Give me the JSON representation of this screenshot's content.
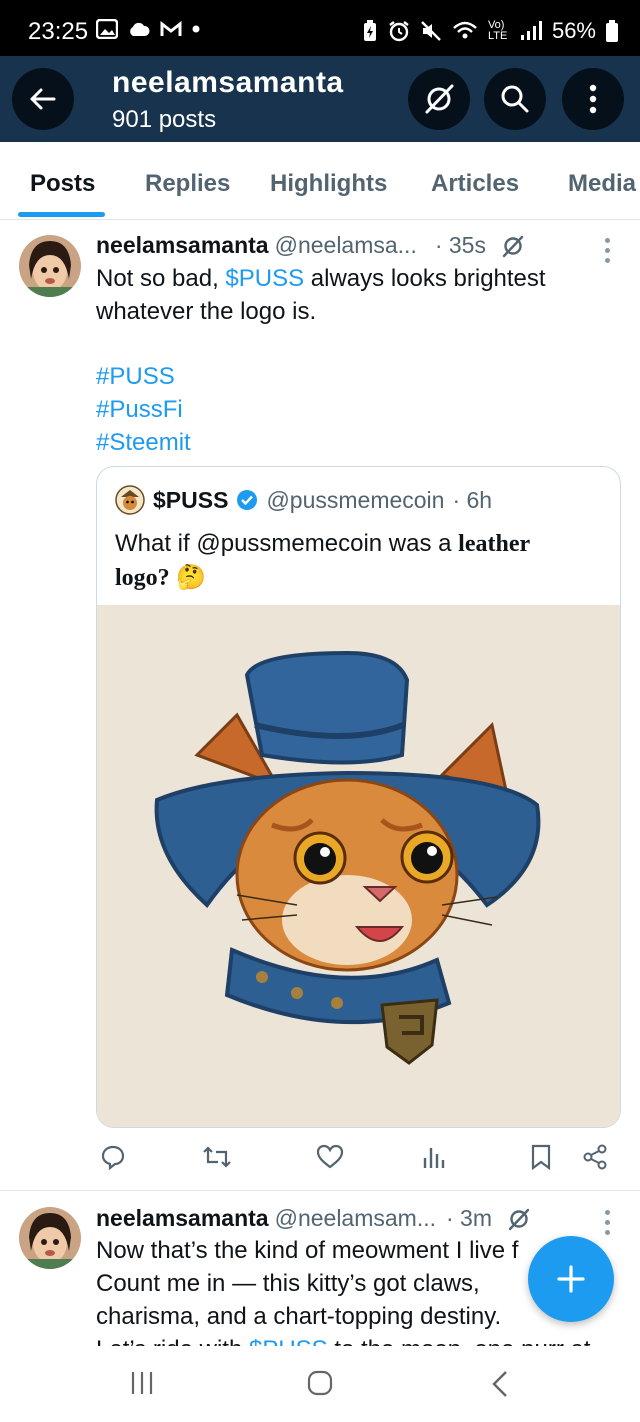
{
  "status_bar": {
    "time": "23:25",
    "battery": "56%",
    "network": "Vo) LTE"
  },
  "header": {
    "title": "neelamsamanta",
    "subtitle": "901 posts"
  },
  "tabs": [
    {
      "label": "Posts",
      "active": true
    },
    {
      "label": "Replies",
      "active": false
    },
    {
      "label": "Highlights",
      "active": false
    },
    {
      "label": "Articles",
      "active": false
    },
    {
      "label": "Media",
      "active": false
    }
  ],
  "post1": {
    "name": "neelamsamanta",
    "handle": "@neelamsa...",
    "time": "· 35s",
    "text_before": "Not so bad, ",
    "cashtag": "$PUSS",
    "text_after": " always looks brightest whatever the logo is.",
    "hashtags": [
      "#PUSS",
      "#PussFi",
      "#Steemit"
    ],
    "quote": {
      "name": "$PUSS",
      "handle": "@pussmemecoin",
      "time": "· 6h",
      "text_plain": "What if @pussmemecoin was a ",
      "text_serif": "leather logo?",
      "emoji": "🤔",
      "image_alt": "leather cat logo with blue hat and collar"
    }
  },
  "post2": {
    "name": "neelamsamanta",
    "handle": "@neelamsam...",
    "time": "· 3m",
    "line1": "Now that’s the kind of meowment I live f",
    "line2": "Count me in — this kitty’s got claws,",
    "line3": "charisma, and a chart-topping destiny.",
    "line4_before": "Let’s ride with ",
    "line4_cashtag": "$PUSS",
    "line4_after": " to the moon, one purr at"
  },
  "colors": {
    "accent": "#1d9bf0",
    "header_bg": "#17334d",
    "verified": "#1d9bf0"
  },
  "icons": {
    "back": "arrow-left-icon",
    "grok": "grok-icon",
    "search": "search-icon",
    "more": "more-vertical-icon",
    "reply": "reply-icon",
    "repost": "repost-icon",
    "like": "heart-icon",
    "views": "views-icon",
    "bookmark": "bookmark-icon",
    "share": "share-icon",
    "compose": "plus-icon"
  }
}
